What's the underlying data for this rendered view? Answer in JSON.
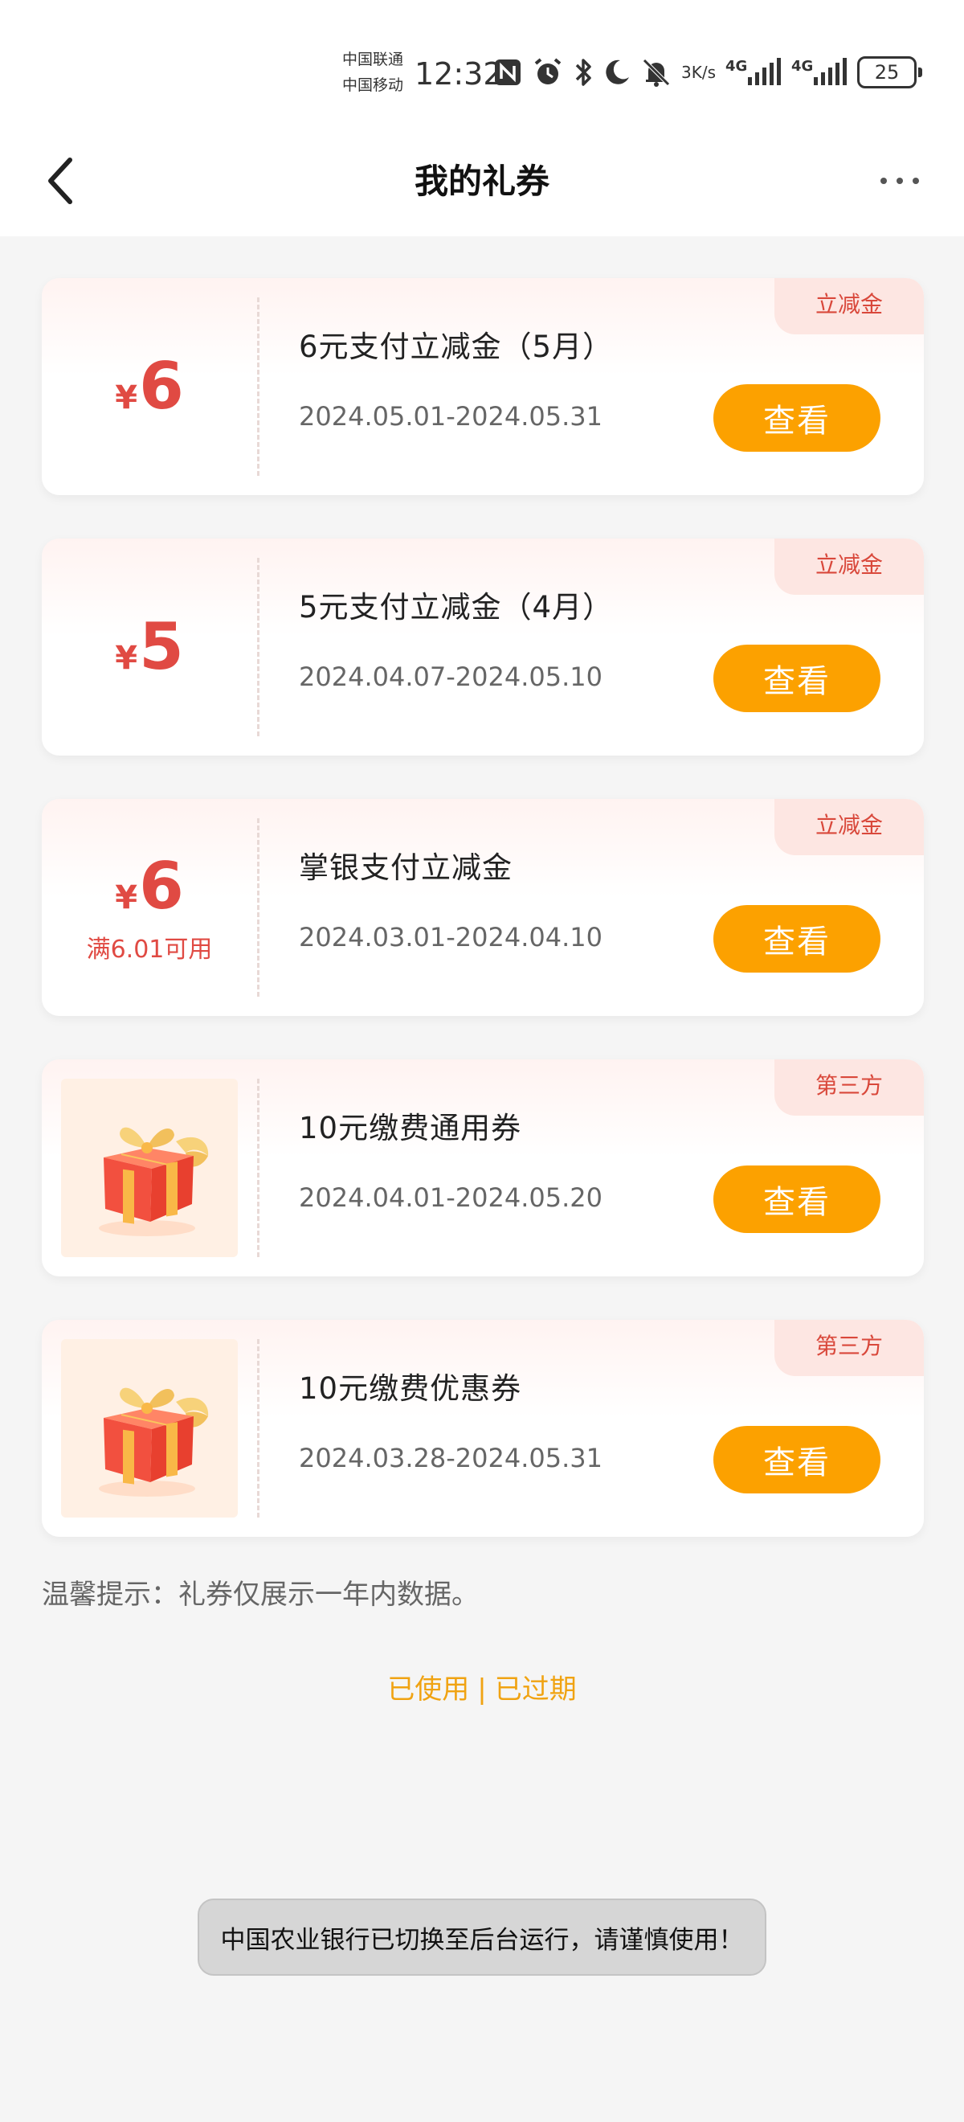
{
  "status_bar": {
    "carrier_1": "中国联通",
    "carrier_2": "中国移动",
    "time": "12:32",
    "net_speed_value": "3",
    "net_speed_unit": "K/s",
    "sim1_tech": "4G",
    "sim2_tech": "4G",
    "battery": "25",
    "icons": [
      "nfc-icon",
      "alarm-icon",
      "bluetooth-icon",
      "moon-icon",
      "mute-icon",
      "signal-icon",
      "battery-icon"
    ]
  },
  "nav": {
    "title": "我的礼券",
    "back_icon": "chevron-left-icon",
    "more_icon": "more-dots-icon"
  },
  "coupons": [
    {
      "type": "amount",
      "currency": "¥",
      "amount": "6",
      "condition": "",
      "title": "6元支付立减金（5月）",
      "date": "2024.05.01-2024.05.31",
      "tag": "立减金",
      "button": "查看"
    },
    {
      "type": "amount",
      "currency": "¥",
      "amount": "5",
      "condition": "",
      "title": "5元支付立减金（4月）",
      "date": "2024.04.07-2024.05.10",
      "tag": "立减金",
      "button": "查看"
    },
    {
      "type": "amount",
      "currency": "¥",
      "amount": "6",
      "condition": "满6.01可用",
      "title": "掌银支付立减金",
      "date": "2024.03.01-2024.04.10",
      "tag": "立减金",
      "button": "查看"
    },
    {
      "type": "gift",
      "icon": "gift-box-icon",
      "title": "10元缴费通用券",
      "date": "2024.04.01-2024.05.20",
      "tag": "第三方",
      "button": "查看"
    },
    {
      "type": "gift",
      "icon": "gift-box-icon",
      "title": "10元缴费优惠券",
      "date": "2024.03.28-2024.05.31",
      "tag": "第三方",
      "button": "查看"
    }
  ],
  "tip": "温馨提示：礼券仅展示一年内数据。",
  "links": {
    "used": "已使用",
    "separator": "|",
    "expired": "已过期"
  },
  "toast": "中国农业银行已切换至后台运行，请谨慎使用！",
  "colors": {
    "accent_button": "#fca100",
    "amount_red": "#e04a43",
    "link_orange": "#f0a312",
    "tag_bg": "#fde6e2"
  }
}
